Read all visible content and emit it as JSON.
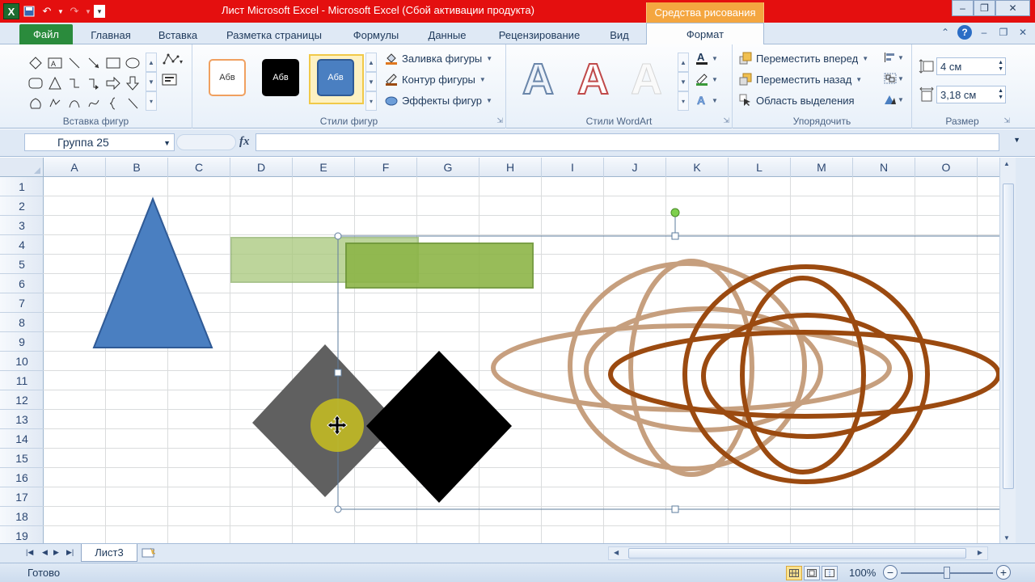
{
  "titlebar": {
    "title": "Лист Microsoft Excel - Microsoft Excel (Сбой активации продукта)",
    "context_tab": "Средства рисования",
    "colors": {
      "bar": "#e40f0f",
      "context": "#f4a640"
    }
  },
  "tabs": {
    "file": "Файл",
    "items": [
      "Главная",
      "Вставка",
      "Разметка страницы",
      "Формулы",
      "Данные",
      "Рецензирование",
      "Вид"
    ],
    "format": "Формат"
  },
  "ribbon": {
    "insert_shapes_label": "Вставка фигур",
    "shape_styles": {
      "label": "Стили фигур",
      "thumb_text": "Абв",
      "fill": "Заливка фигуры",
      "outline": "Контур фигуры",
      "effects": "Эффекты фигур"
    },
    "wordart": {
      "label": "Стили WordArt",
      "letter": "A"
    },
    "arrange": {
      "label": "Упорядочить",
      "forward": "Переместить вперед",
      "backward": "Переместить назад",
      "selection": "Область выделения"
    },
    "size": {
      "label": "Размер",
      "height": "4 см",
      "width": "3,18 см"
    }
  },
  "formula_bar": {
    "name_box": "Группа 25",
    "fx": "fx"
  },
  "grid": {
    "columns": [
      "A",
      "B",
      "C",
      "D",
      "E",
      "F",
      "G",
      "H",
      "I",
      "J",
      "K",
      "L",
      "M",
      "N",
      "O"
    ],
    "rows": [
      "1",
      "2",
      "3",
      "4",
      "5",
      "6",
      "7",
      "8",
      "9",
      "10",
      "11",
      "12",
      "13",
      "14",
      "15",
      "16",
      "17",
      "18",
      "19"
    ]
  },
  "shape_colors": {
    "triangle": "#4a7fc1",
    "green_light": "#a8c87a",
    "green": "#8db548",
    "diamond_gray": "#606060",
    "diamond_black": "#000000",
    "ellipse_light": "#c49a78",
    "ellipse_dark": "#9b4a10",
    "cursor_spot": "#c8c020"
  },
  "sheets": {
    "active": "Лист3"
  },
  "status": {
    "text": "Готово",
    "zoom": "100%"
  }
}
